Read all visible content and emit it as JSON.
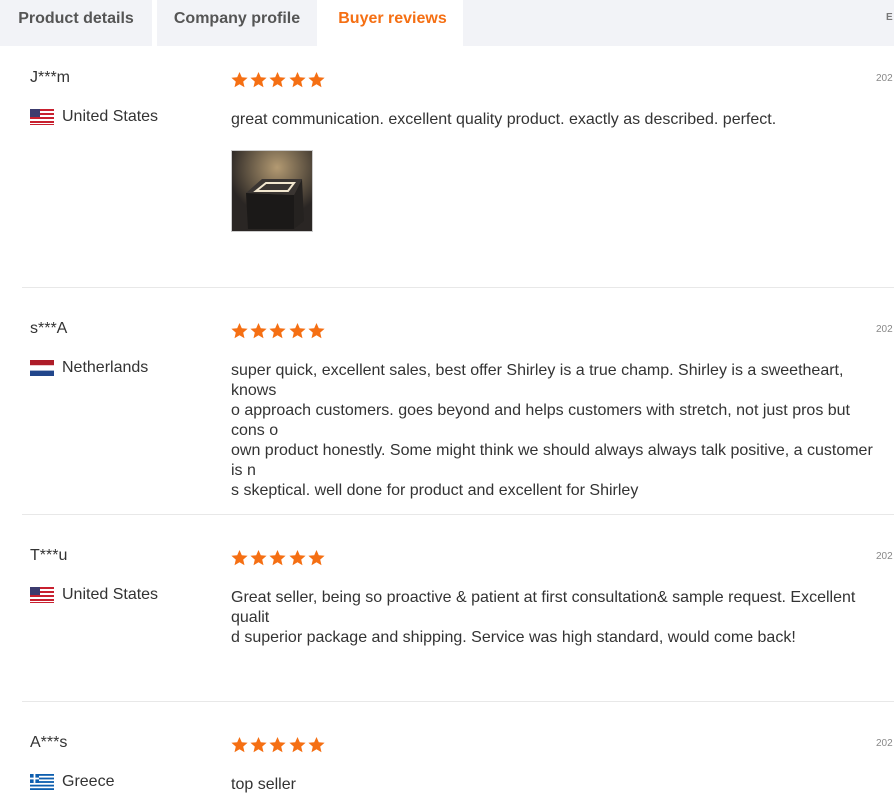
{
  "tabs": [
    {
      "label": "Product details"
    },
    {
      "label": "Company profile"
    },
    {
      "label": "Buyer reviews"
    }
  ],
  "tab_more": "E",
  "colors": {
    "accent": "#f56f13",
    "star": "#f56f13"
  },
  "reviews": [
    {
      "buyer": "J***m",
      "country": "United States",
      "flag_icon": "us-flag-icon",
      "rating": 5,
      "date": "202",
      "text": "great communication. excellent quality product. exactly as described. perfect.",
      "has_photo": true
    },
    {
      "buyer": "s***A",
      "country": "Netherlands",
      "flag_icon": "nl-flag-icon",
      "rating": 5,
      "date": "202",
      "text": "super quick, excellent sales, best offer Shirley is a true champ. Shirley is a sweetheart, knows\no approach customers. goes beyond and helps customers with stretch, not just pros but cons o\nown product honestly. Some might think we should always always talk positive, a customer is n\ns skeptical. well done for product and excellent for Shirley",
      "has_photo": false
    },
    {
      "buyer": "T***u",
      "country": "United States",
      "flag_icon": "us-flag-icon",
      "rating": 5,
      "date": "202",
      "text": "Great seller, being so proactive & patient at first consultation& sample request. Excellent qualit\nd superior package and shipping. Service was high standard, would come back!",
      "has_photo": false
    },
    {
      "buyer": "A***s",
      "country": "Greece",
      "flag_icon": "gr-flag-icon",
      "rating": 5,
      "date": "202",
      "text": "top seller",
      "has_photo": false
    }
  ]
}
